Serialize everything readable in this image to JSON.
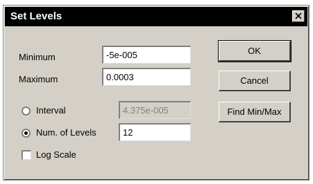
{
  "dialog": {
    "title": "Set Levels",
    "close_icon": "close-icon"
  },
  "fields": {
    "minimum_label": "Minimum",
    "minimum_value": "-5e-005",
    "maximum_label": "Maximum",
    "maximum_value": "0.0003",
    "interval_label": "Interval",
    "interval_value": "4.375e-005",
    "num_levels_label": "Num. of Levels",
    "num_levels_value": "12",
    "log_scale_label": "Log Scale"
  },
  "selection": {
    "interval_selected": false,
    "num_levels_selected": true,
    "log_scale_checked": false
  },
  "buttons": {
    "ok": "OK",
    "cancel": "Cancel",
    "find_min_max": "Find Min/Max"
  }
}
